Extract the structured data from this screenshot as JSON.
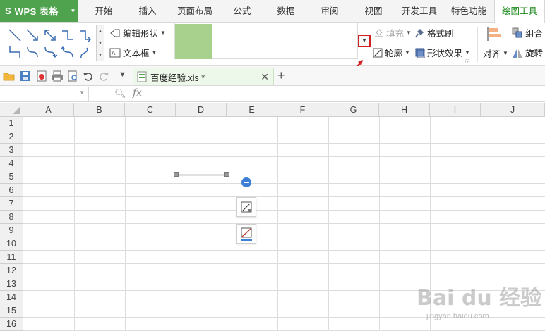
{
  "app": {
    "logo": "S",
    "title": "WPS 表格"
  },
  "tabs": [
    {
      "label": "开始"
    },
    {
      "label": "插入"
    },
    {
      "label": "页面布局"
    },
    {
      "label": "公式"
    },
    {
      "label": "数据"
    },
    {
      "label": "审阅"
    },
    {
      "label": "视图"
    },
    {
      "label": "开发工具"
    },
    {
      "label": "特色功能"
    },
    {
      "label": "绘图工具",
      "active": true
    }
  ],
  "ribbon": {
    "edit_shape": "编辑形状",
    "text_box": "文本框",
    "fill": "填充",
    "format_painter": "格式刷",
    "outline": "轮廓",
    "shape_effects": "形状效果",
    "align": "对齐",
    "group": "组合",
    "rotate": "旋转",
    "line_style_colors": [
      "#222222",
      "#5b9bd5",
      "#ed7d31",
      "#a5a5a5",
      "#ffc000"
    ]
  },
  "quick_access": {
    "document_tab": "百度经验.xls *"
  },
  "formula_bar": {
    "fx_label": "fx",
    "name_box": "",
    "formula": ""
  },
  "grid": {
    "columns": [
      "A",
      "B",
      "C",
      "D",
      "E",
      "F",
      "G",
      "H",
      "I",
      "J"
    ],
    "rows": [
      "1",
      "2",
      "3",
      "4",
      "5",
      "6",
      "7",
      "8",
      "9",
      "10",
      "11",
      "12",
      "13",
      "14",
      "15",
      "16"
    ]
  },
  "watermark": {
    "brand": "Bai du 经验",
    "url": "jingyan.baidu.com"
  },
  "colors": {
    "accent_green": "#4fa34f",
    "active_tab_text": "#1f8b1f",
    "highlight_red": "#d21f1f",
    "selected_style": "#a9d18e"
  }
}
